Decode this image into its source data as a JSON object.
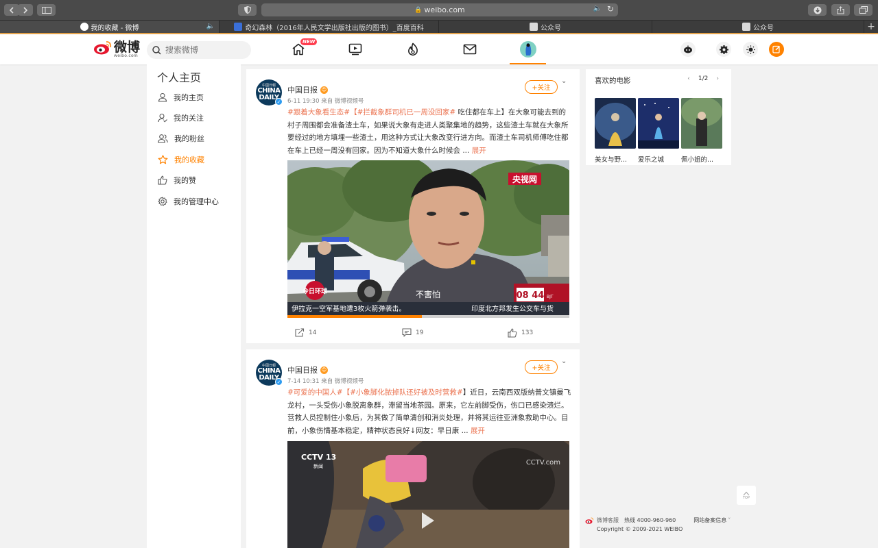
{
  "browser": {
    "url": "weibo.com",
    "tabs": [
      {
        "title": "我的收藏 - 微博"
      },
      {
        "title": "奇幻森林（2016年人民文学出版社出版的图书）_百度百科"
      },
      {
        "title": "公众号"
      },
      {
        "title": "公众号"
      }
    ]
  },
  "header": {
    "logo_text": "微博",
    "logo_sub": "weibo.com",
    "search_placeholder": "搜索微博",
    "new_badge": "NEW"
  },
  "sidebar": {
    "title": "个人主页",
    "items": [
      {
        "label": "我的主页"
      },
      {
        "label": "我的关注"
      },
      {
        "label": "我的粉丝"
      },
      {
        "label": "我的收藏"
      },
      {
        "label": "我的赞"
      },
      {
        "label": "我的管理中心"
      }
    ]
  },
  "posts": [
    {
      "avatar_line1": "中國日報",
      "avatar_line2": "CHINA",
      "avatar_line3": "DAILY",
      "author": "中国日报",
      "meta": "6-11 19:30  来自 微博视频号",
      "follow": "+关注",
      "tag1": "#跟着大象看生态#",
      "tag2": "【#拦截象群司机已一周没回家#",
      "body": " 吃住都在车上】在大象可能去到的村子周围都会准备渣土车，如果说大象有走进人类聚集地的趋势，这些渣土车就在大象所要经过的地方填埋一些渣土，用这种方式让大象改变行进方向。而渣土车司机师傅吃住都在车上已经一周没有回家。因为不知道大象什么时候会 ...",
      "expand": "展开",
      "video": {
        "top_right_logo": "央视网",
        "subtitle": "不害怕",
        "clock": "08 44",
        "clock_suffix": "BJT",
        "ticker_left": "伊拉克一空军基地遭3枚火箭弹袭击。",
        "ticker_right": "印度北方邦发生公交车与货",
        "program": "今日环球"
      },
      "reposts": "14",
      "comments": "19",
      "likes": "133"
    },
    {
      "avatar_line1": "中國日報",
      "avatar_line2": "CHINA",
      "avatar_line3": "DAILY",
      "author": "中国日报",
      "meta": "7-14 10:31  来自 微博视频号",
      "follow": "+关注",
      "tag1": "#可爱的中国人#",
      "tag2": "【#小象脚化脓掉队还好被及时营救#",
      "body": "】近日，云南西双版纳普文镇曼飞龙村，一头受伤小象脱离象群，滞留当地茶园。原来，它左前脚受伤，伤口已感染溃烂。营救人员控制住小象后，为其做了简单清创和消炎处理，并将其运往亚洲象救助中心。目前，小象伤情基本稳定，精神状态良好↓网友：早日康 ...",
      "expand": "展开",
      "video": {
        "channel": "CCTV 13",
        "channel_sub": "新闻",
        "watermark": "CCTV.com"
      }
    }
  ],
  "movies": {
    "title": "喜欢的电影",
    "pager": "1/2",
    "items": [
      {
        "title": "美女与野..."
      },
      {
        "title": "爱乐之城"
      },
      {
        "title": "佩小姐的..."
      }
    ]
  },
  "back_to_top": "TOP",
  "footer": {
    "service": "微博客服",
    "hotline": "热线 4000-960-960",
    "icp": "网站备案信息",
    "copyright": "Copyright © 2009-2021 WEIBO"
  }
}
